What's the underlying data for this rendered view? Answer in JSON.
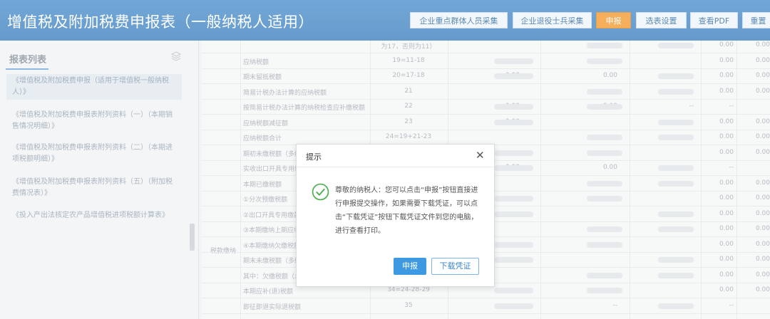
{
  "app": {
    "title": "增值税及附加税费申报表（一般纳税人适用）"
  },
  "header_buttons": [
    "企业重点群体人员采集",
    "企业退役士兵采集",
    "申报",
    "选表设置",
    "查看PDF",
    "重置"
  ],
  "sidebar": {
    "title": "报表列表",
    "items": [
      "《增值税及附加税费申报（适用于增值税一般纳税人）》",
      "《增值税及附加税费申报表附列资料（一）（本期销售情况明细）》",
      "《增值税及附加税费申报表附列资料（二）（本期进项税额明细）》",
      "《增值税及附加税费申报表附列资料（五）（附加税费情况表）》",
      "《投入产出法核定农产品增值税进项税额计算表》"
    ]
  },
  "table": {
    "group_label": "税款缴纳",
    "rows": [
      {
        "label": "",
        "code": "为17，否则为11）",
        "c1": "",
        "c2": "",
        "c4": "",
        "c6": "0.00",
        "c7": "0.00"
      },
      {
        "label": "应纳税额",
        "code": "19=11-18",
        "c1": "",
        "c2": "",
        "c4": "",
        "c6": "0.00",
        "c7": "0.00"
      },
      {
        "label": "期末留抵税额",
        "code": "20=17-18",
        "c1": "0.00",
        "c2": "0.00",
        "c4": "",
        "c6": "0.00",
        "c7": "0.00"
      },
      {
        "label": "简易计税办法计算的应纳税额",
        "code": "21",
        "c1": "",
        "c2": "",
        "c4": "",
        "c6": "0.00",
        "c7": "0.00"
      },
      {
        "label": "按简易计税办法计算的纳税检查应补缴税额",
        "code": "22",
        "c1": "0.00",
        "c2": "0.00",
        "c4": "--",
        "c6": "--",
        "c7": ""
      },
      {
        "label": "应纳税额减征额",
        "code": "23",
        "c1": "0.00",
        "c2": "",
        "c4": "",
        "c6": "0.00",
        "c7": "0.00"
      },
      {
        "label": "应纳税额合计",
        "code": "24=19+21-23",
        "c1": "",
        "c2": "",
        "c4": "",
        "c6": "0.00",
        "c7": "0.00"
      },
      {
        "label": "期初未缴税额（多缴为负数）",
        "code": "",
        "c1": "",
        "c2": "",
        "c4": "",
        "c6": "0.00",
        "c7": "0.00"
      },
      {
        "label": "实收出口开具专用缴款书退税额",
        "code": "",
        "c1": "0.00",
        "c2": "0.00",
        "c4": "--",
        "c6": "--",
        "c7": ""
      },
      {
        "label": "本期已缴税额",
        "code": "",
        "c1": "",
        "c2": "",
        "c4": "",
        "c6": "0.00",
        "c7": "0.00"
      },
      {
        "label": "①分次预缴税额",
        "code": "",
        "c1": "",
        "c2": "",
        "c4": "",
        "c6": "0.00",
        "c7": "0.00"
      },
      {
        "label": "②出口开具专用缴款书预缴税额",
        "code": "",
        "c1": "",
        "c2": "",
        "c4": "",
        "c6": "0.00",
        "c7": "0.00"
      },
      {
        "label": "③本期缴纳上期应纳税额",
        "code": "",
        "c1": "",
        "c2": "",
        "c4": "",
        "c6": "0.00",
        "c7": "0.00"
      },
      {
        "label": "④本期缴纳欠缴税额",
        "code": "",
        "c1": "",
        "c2": "",
        "c4": "",
        "c6": "0.00",
        "c7": "0.00"
      },
      {
        "label": "期末未缴税额（多缴为负数）",
        "code": "",
        "c1": "",
        "c2": "",
        "c4": "",
        "c6": "0.00",
        "c7": "0.00"
      },
      {
        "label": "其中：欠缴税额（≥0）",
        "code": "",
        "c1": "",
        "c2": "",
        "c4": "",
        "c6": "0.00",
        "c7": "0.00"
      },
      {
        "label": "本期应补(退)税额",
        "code": "34=24-28-29",
        "c1": "",
        "c2": "",
        "c4": "",
        "c6": "0.00",
        "c7": "0.00"
      },
      {
        "label": "即征即退实际退税额",
        "code": "35",
        "c1": "--",
        "c2": "--",
        "c4": "",
        "c6": "--",
        "c7": ""
      }
    ]
  },
  "dialog": {
    "title": "提示",
    "message": "尊敬的纳税人：您可以点击“申报”按钮直接进行申报提交操作，如果需要下载凭证，可以点击“下载凭证”按钮下载凭证文件到您的电脑，进行查看打印。",
    "confirm_label": "申报",
    "download_label": "下载凭证"
  },
  "colors": {
    "header_bg": "#2f78bb",
    "primary_button": "#f28f1a",
    "dialog_button": "#3d9ae2",
    "ok_icon": "#4cb050"
  }
}
